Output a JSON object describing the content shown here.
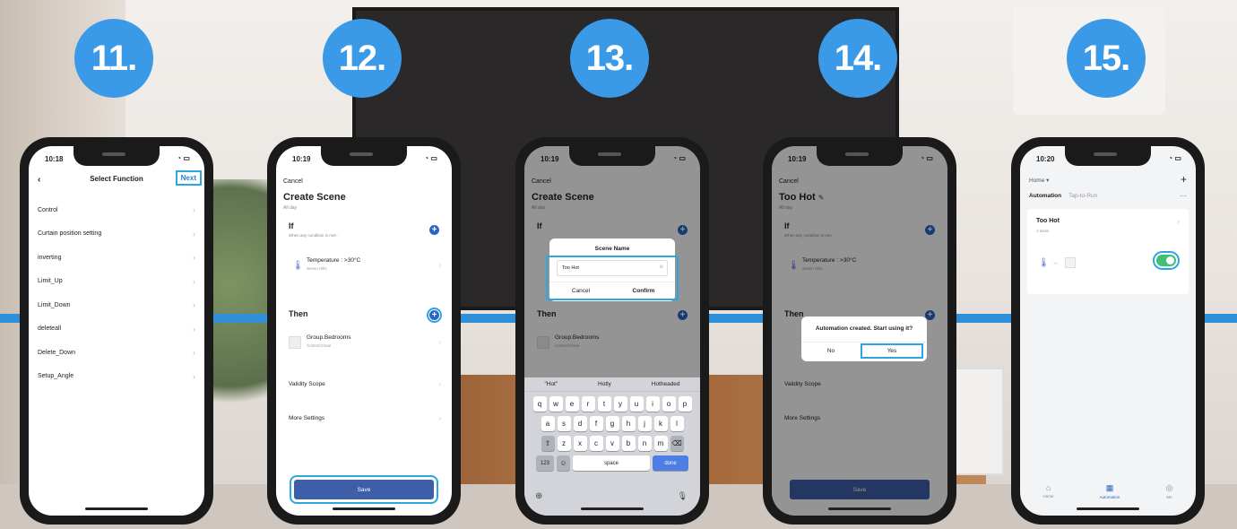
{
  "steps": [
    "11.",
    "12.",
    "13.",
    "14.",
    "15."
  ],
  "status_time": [
    "10:18",
    "10:19",
    "10:19",
    "10:19",
    "10:20"
  ],
  "phone11": {
    "title": "Select Function",
    "next": "Next",
    "back": "‹",
    "functions": [
      "Control",
      "Curtain position setting",
      "inverting",
      "Limit_Up",
      "Limit_Down",
      "deleteall",
      "Delete_Down",
      "Setup_Angle"
    ]
  },
  "scene": {
    "cancel": "Cancel",
    "title": "Create Scene",
    "all_day": "All day",
    "if_label": "If",
    "if_sub": "When any condition is met ·",
    "condition": "Temperature : >30°C",
    "condition_sub": "Seven Hills",
    "then_label": "Then",
    "action": "Group.Bedrooms",
    "action_sub": "Control:Close",
    "validity": "Validity Scope",
    "more": "More Settings",
    "save": "Save"
  },
  "phone13": {
    "modal_title": "Scene Name",
    "field_value": "Too Hot",
    "cancel": "Cancel",
    "confirm": "Confirm",
    "suggestions": [
      "\"Hot\"",
      "Hotly",
      "Hotheaded"
    ],
    "row1": [
      "q",
      "w",
      "e",
      "r",
      "t",
      "y",
      "u",
      "i",
      "o",
      "p"
    ],
    "row2": [
      "a",
      "s",
      "d",
      "f",
      "g",
      "h",
      "j",
      "k",
      "l"
    ],
    "row3": [
      "z",
      "x",
      "c",
      "v",
      "b",
      "n",
      "m"
    ],
    "num_key": "123",
    "space": "space",
    "done": "done"
  },
  "phone14": {
    "title": "Too Hot",
    "prompt": "Automation created. Start using it?",
    "no": "No",
    "yes": "Yes"
  },
  "phone15": {
    "home": "Home ▾",
    "tab_automation": "Automation",
    "tab_tap": "Tap-to-Run",
    "card_title": "Too Hot",
    "card_sub": "1 tasks",
    "nav_home": "Home",
    "nav_automation": "Automation",
    "nav_me": "Me"
  },
  "colors": {
    "badge": "#3b9ae8",
    "highlight": "#2aa7e0",
    "primary": "#3e5ea9",
    "toggle_on": "#3fbf7a"
  }
}
